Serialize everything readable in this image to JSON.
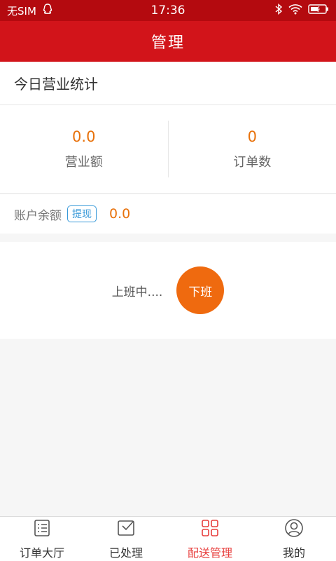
{
  "status_bar": {
    "carrier": "无SIM",
    "time": "17:36",
    "icons": [
      "qq-icon",
      "bluetooth-icon",
      "wifi-icon",
      "battery-icon"
    ]
  },
  "header": {
    "title": "管理"
  },
  "today_stats": {
    "title": "今日营业统计",
    "revenue": {
      "value": "0.0",
      "label": "营业额"
    },
    "orders": {
      "value": "0",
      "label": "订单数"
    }
  },
  "account": {
    "label": "账户余额",
    "withdraw_label": "提现",
    "balance": "0.0"
  },
  "duty": {
    "status": "上班中....",
    "button_label": "下班"
  },
  "tabs": [
    {
      "label": "订单大厅",
      "icon": "list-icon",
      "active": false
    },
    {
      "label": "已处理",
      "icon": "check-box-icon",
      "active": false
    },
    {
      "label": "配送管理",
      "icon": "grid-icon",
      "active": true
    },
    {
      "label": "我的",
      "icon": "user-icon",
      "active": false
    }
  ],
  "colors": {
    "status_bar": "#b40a0f",
    "title_bar": "#d2141a",
    "accent_orange": "#e8720c",
    "button_orange": "#ef6a0f",
    "active_tab": "#e8403f",
    "link_blue": "#3a9ad9"
  }
}
